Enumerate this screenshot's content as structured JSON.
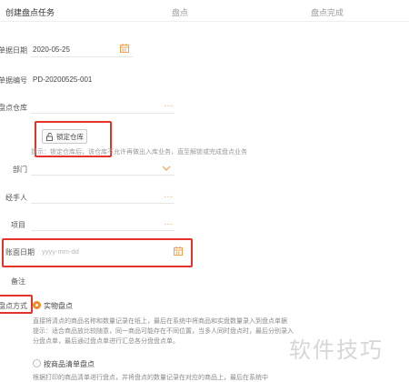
{
  "steps": [
    "创建盘点任务",
    "盘点",
    "盘点完成"
  ],
  "form": {
    "doc_date_label": "单据日期",
    "doc_date_value": "2020-05-25",
    "doc_no_label": "单据编号",
    "doc_no_value": "PD-20200525-001",
    "warehouse_label": "盘点仓库",
    "lock_button": "锁定仓库",
    "lock_hint": "提示：锁定仓库后，该仓库不允许再做出入库业务，直至解锁或完成盘点业务",
    "dept_label": "部门",
    "handler_label": "经手人",
    "project_label": "项目",
    "account_date_label": "账面日期",
    "account_date_placeholder": "yyyy-mm-dd",
    "remark_label": "备注",
    "method_label": "盘点方式",
    "option_physical": "实物盘点",
    "option_physical_desc1": "直接将清点的商品名称和数量记录在纸上，最后在系统中将商品和实盘数量录入到盘点单据",
    "option_physical_desc2": "提示：适合商品放比较随意，同一商品可能存在不同位置，当多人同时盘点时，最后分别录入",
    "option_physical_desc3": "分盘点单，最后通过盘点单进行汇总各分盘盘点单。",
    "option_list": "按商品清单盘点",
    "option_list_desc": "根据打印的商品清单进行盘点，并将盘点的数量记录在对应的商品上，最后在系统中"
  },
  "watermark": "软件技巧",
  "colors": {
    "accent": "#f08a2a",
    "highlight": "#e63329"
  }
}
